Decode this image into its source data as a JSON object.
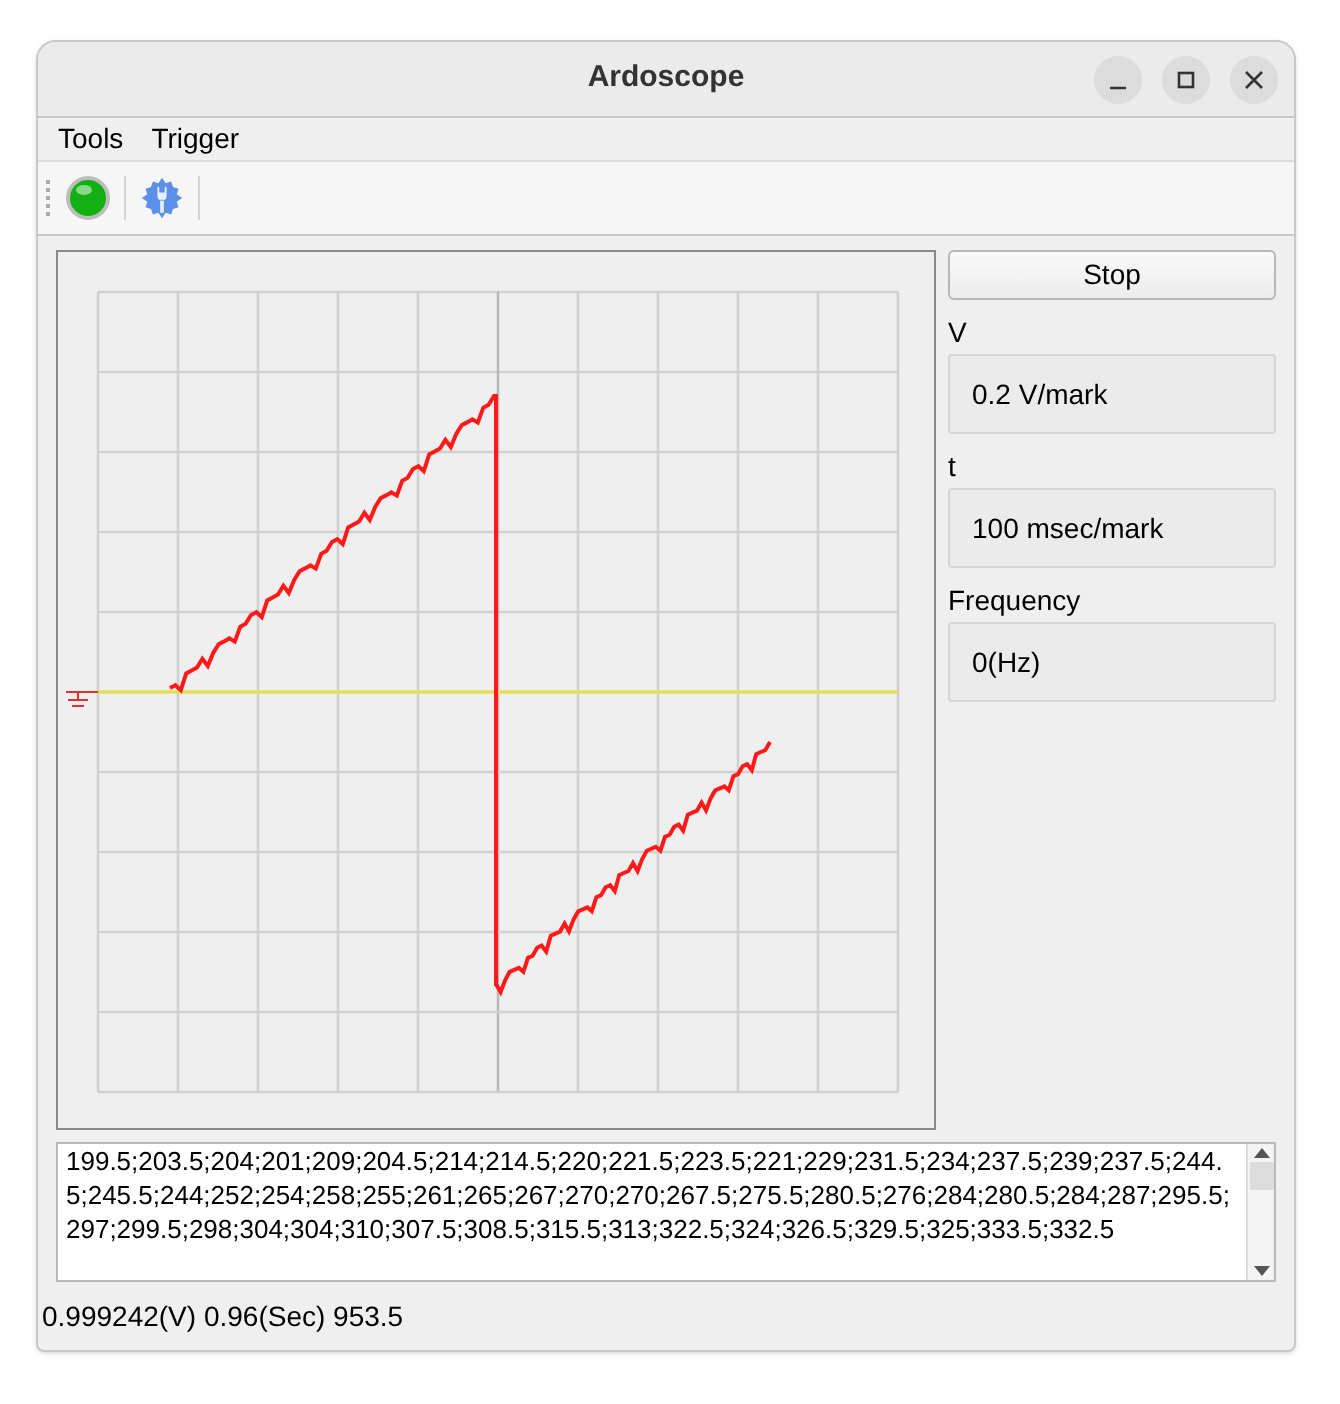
{
  "window": {
    "title": "Ardoscope"
  },
  "menu": [
    "Tools",
    "Trigger"
  ],
  "toolbar": {
    "running": true
  },
  "controls": {
    "button": "Stop",
    "fields": [
      {
        "label": "V",
        "value": "0.2 V/mark"
      },
      {
        "label": "t",
        "value": "100 msec/mark"
      },
      {
        "label": "Frequency",
        "value": "0(Hz)"
      }
    ]
  },
  "data_text": "199.5;203.5;204;201;209;204.5;214;214.5;220;221.5;223.5;221;229;231.5;234;237.5;239;237.5;244.5;245.5;244;252;254;258;255;261;265;267;270;270;267.5;275.5;280.5;276;284;280.5;284;287;295.5;297;299.5;298;304;304;310;307.5;308.5;315.5;313;322.5;324;326.5;329.5;325;333.5;332.5",
  "status_bar": "0.999242(V) 0.96(Sec) 953.5"
}
